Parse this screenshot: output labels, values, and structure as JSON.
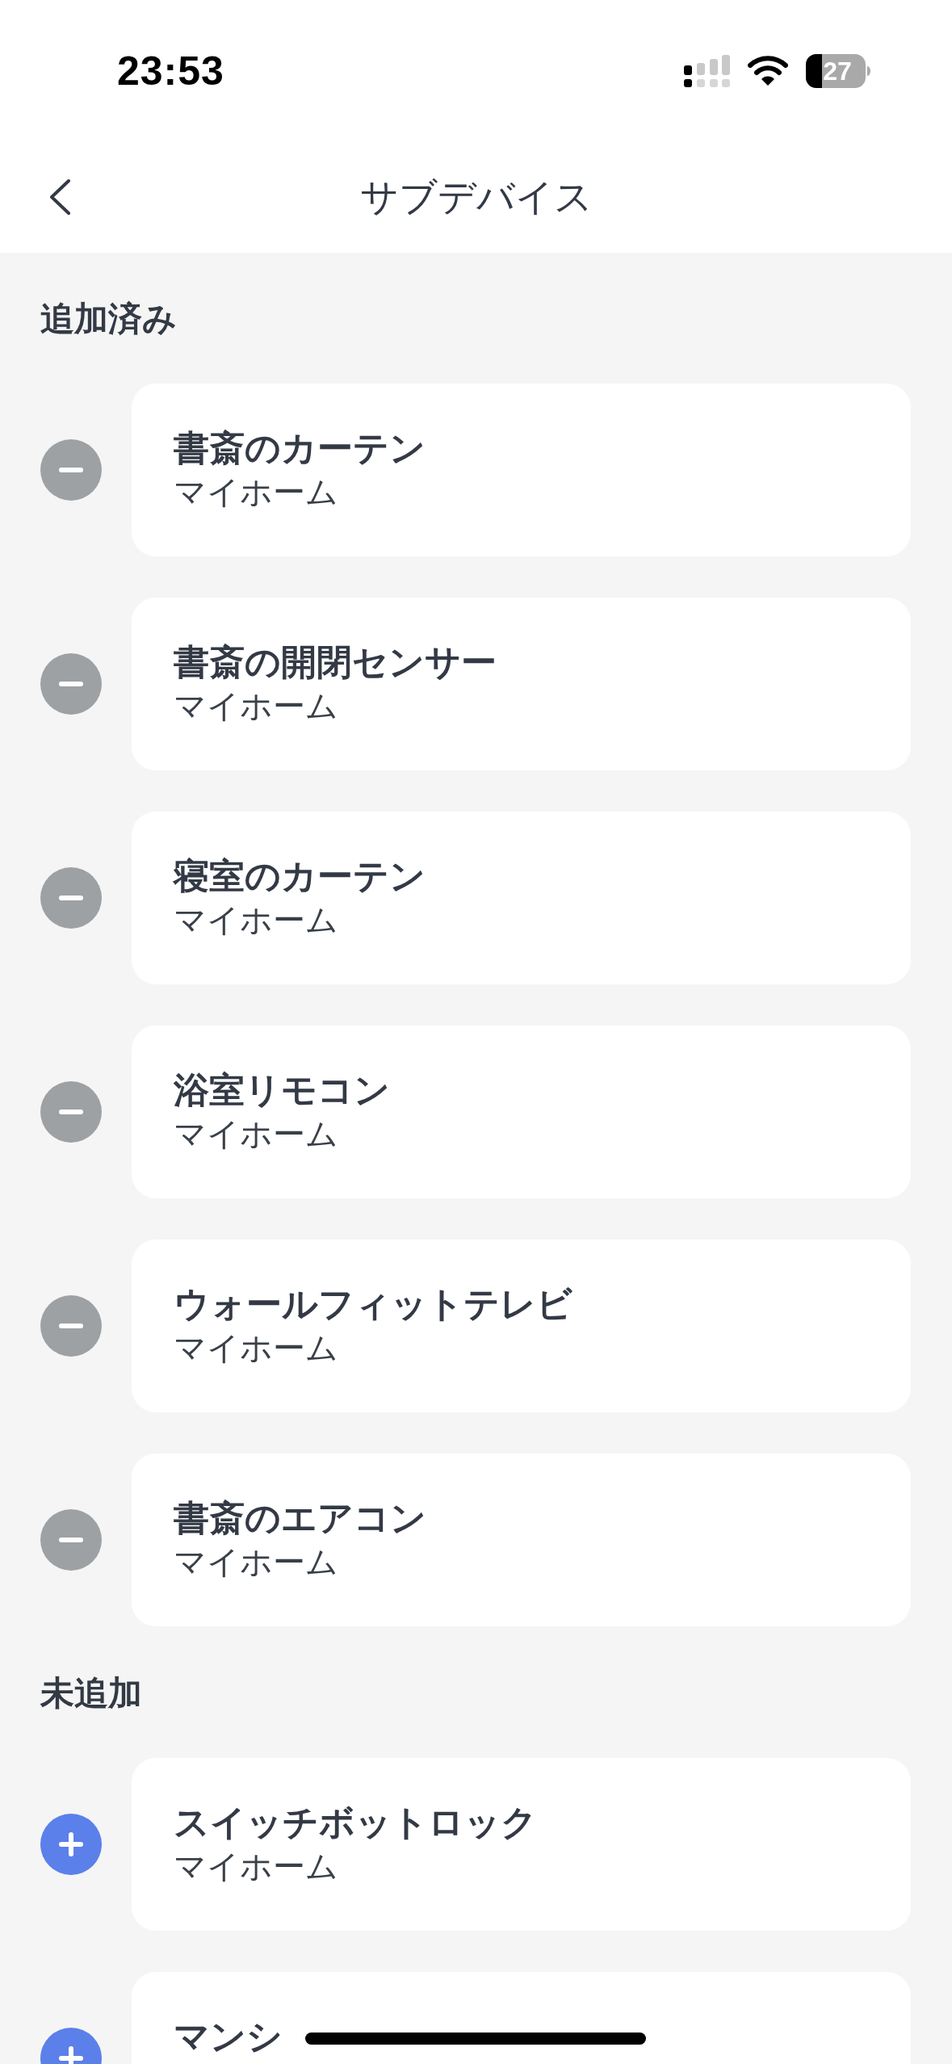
{
  "status_bar": {
    "time": "23:53",
    "battery": "27"
  },
  "header": {
    "title": "サブデバイス"
  },
  "sections": [
    {
      "title": "追加済み",
      "devices": [
        {
          "name": "書斎のカーテン",
          "home": "マイホーム",
          "kind": "remove"
        },
        {
          "name": "書斎の開閉センサー",
          "home": "マイホーム",
          "kind": "remove"
        },
        {
          "name": "寝室のカーテン",
          "home": "マイホーム",
          "kind": "remove"
        },
        {
          "name": "浴室リモコン",
          "home": "マイホーム",
          "kind": "remove"
        },
        {
          "name": "ウォールフィットテレビ",
          "home": "マイホーム",
          "kind": "remove"
        },
        {
          "name": "書斎のエアコン",
          "home": "マイホーム",
          "kind": "remove"
        }
      ]
    },
    {
      "title": "未追加",
      "devices": [
        {
          "name": "スイッチボットロック",
          "home": "マイホーム",
          "kind": "add"
        },
        {
          "name": "マンシ",
          "kind": "add"
        }
      ]
    }
  ]
}
